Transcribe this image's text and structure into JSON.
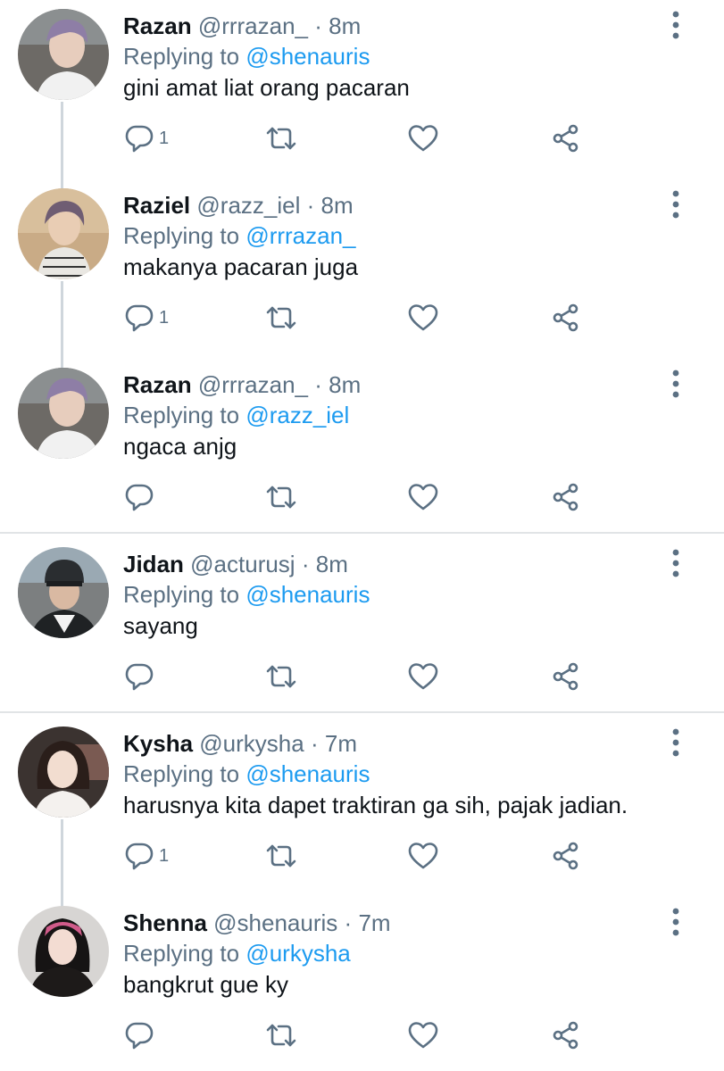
{
  "tweets": [
    {
      "name": "Razan",
      "handle": "@rrrazan_",
      "separator": "·",
      "time": "8m",
      "replying_label": "Replying to",
      "replying_to": "@shenauris",
      "text": "gini amat liat orang pacaran",
      "reply_count": "1",
      "avatar": "avatar-razan"
    },
    {
      "name": "Raziel",
      "handle": "@razz_iel",
      "separator": "·",
      "time": "8m",
      "replying_label": "Replying to",
      "replying_to": "@rrrazan_",
      "text": "makanya pacaran juga",
      "reply_count": "1",
      "avatar": "avatar-raziel"
    },
    {
      "name": "Razan",
      "handle": "@rrrazan_",
      "separator": "·",
      "time": "8m",
      "replying_label": "Replying to",
      "replying_to": "@razz_iel",
      "text": "ngaca anjg",
      "reply_count": "",
      "avatar": "avatar-razan"
    },
    {
      "name": "Jidan",
      "handle": "@acturusj",
      "separator": "·",
      "time": "8m",
      "replying_label": "Replying to",
      "replying_to": "@shenauris",
      "text": "sayang",
      "reply_count": "",
      "avatar": "avatar-jidan"
    },
    {
      "name": "Kysha",
      "handle": "@urkysha",
      "separator": "·",
      "time": "7m",
      "replying_label": "Replying to",
      "replying_to": "@shenauris",
      "text": "harusnya kita dapet traktiran ga sih, pajak jadian.",
      "reply_count": "1",
      "avatar": "avatar-kysha"
    },
    {
      "name": "Shenna",
      "handle": "@shenauris",
      "separator": "·",
      "time": "7m",
      "replying_label": "Replying to",
      "replying_to": "@urkysha",
      "text": "bangkrut gue ky",
      "reply_count": "",
      "avatar": "avatar-shenna"
    }
  ],
  "icons": {
    "reply": "reply-icon",
    "retweet": "retweet-icon",
    "like": "like-icon",
    "share": "share-icon",
    "more": "more-icon"
  },
  "colors": {
    "name": "#0f1419",
    "secondary_text": "#5b7083",
    "mention": "#1d9bf0",
    "thread_line": "#cfd6dc",
    "divider": "#e1e4e6"
  }
}
